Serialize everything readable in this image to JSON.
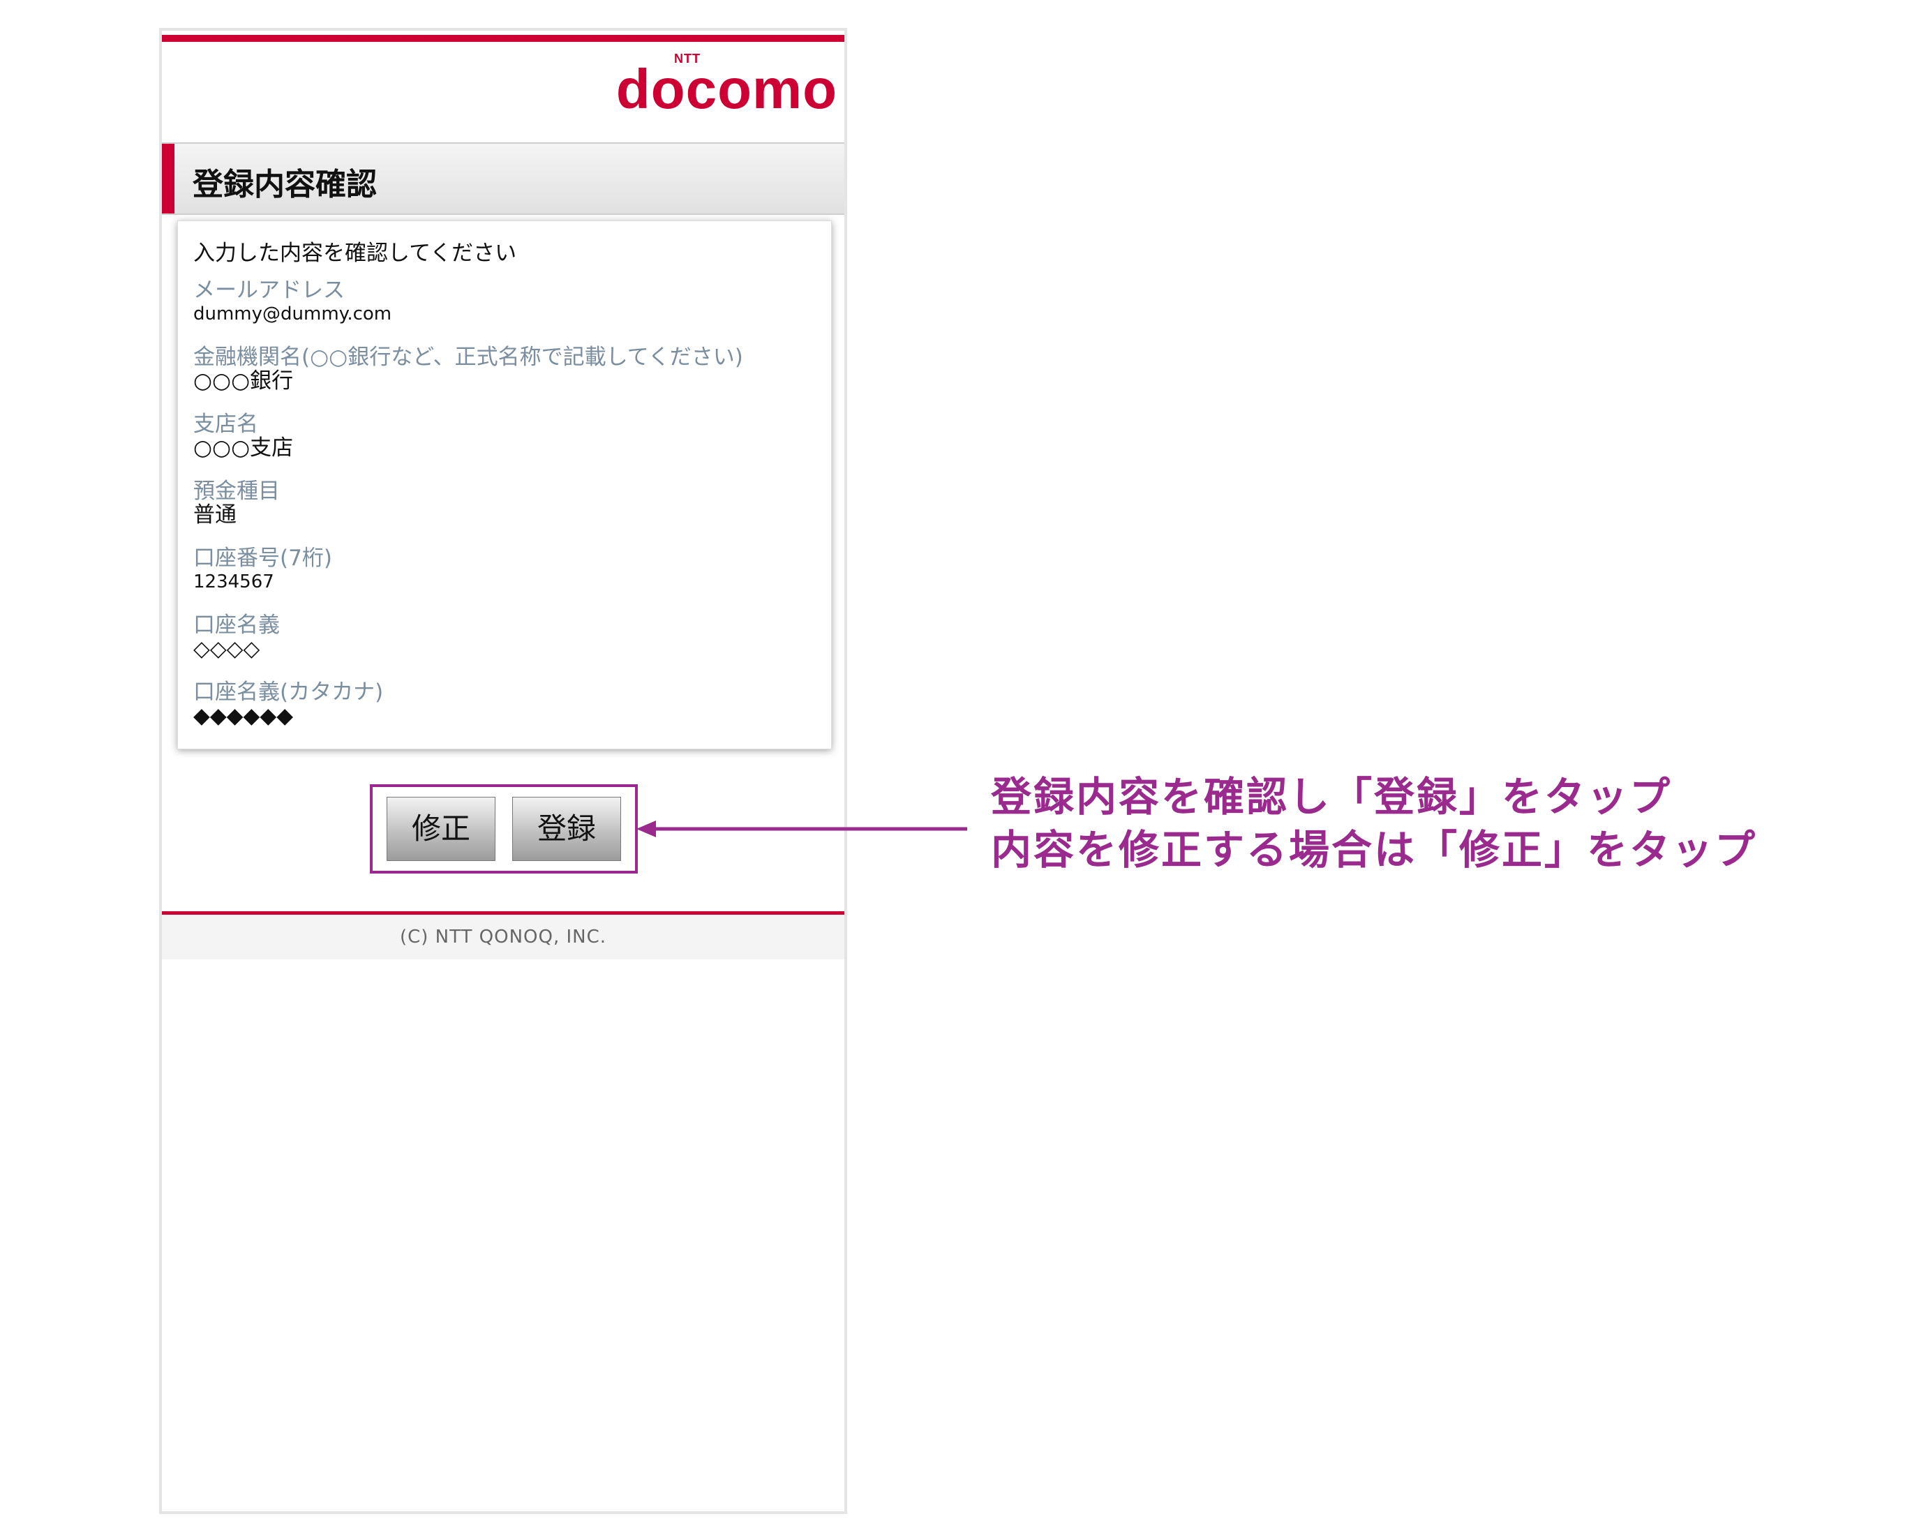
{
  "header": {
    "logo_small": "NTT",
    "logo_text": "docomo",
    "title": "登録内容確認"
  },
  "card": {
    "instruction": "入力した内容を確認してください",
    "fields": [
      {
        "label": "メールアドレス",
        "value": "dummy@dummy.com"
      },
      {
        "label": "金融機関名(○○銀行など、正式名称で記載してください)",
        "value": "○○○銀行"
      },
      {
        "label": "支店名",
        "value": "○○○支店"
      },
      {
        "label": "預金種目",
        "value": "普通"
      },
      {
        "label": "口座番号(7桁)",
        "value": "1234567"
      },
      {
        "label": "口座名義",
        "value": "◇◇◇◇"
      },
      {
        "label": "口座名義(カタカナ)",
        "value": "◆◆◆◆◆◆"
      }
    ]
  },
  "buttons": {
    "fix_label": "修正",
    "register_label": "登録"
  },
  "footer": {
    "copyright": "(C) NTT QONOQ, INC."
  },
  "annotation": {
    "line1": "登録内容を確認し「登録」をタップ",
    "line2": "内容を修正する場合は「修正」をタップ",
    "color": "#9b2a8f"
  },
  "colors": {
    "brand_red": "#cc0033",
    "label_gray": "#7a8ea0"
  }
}
